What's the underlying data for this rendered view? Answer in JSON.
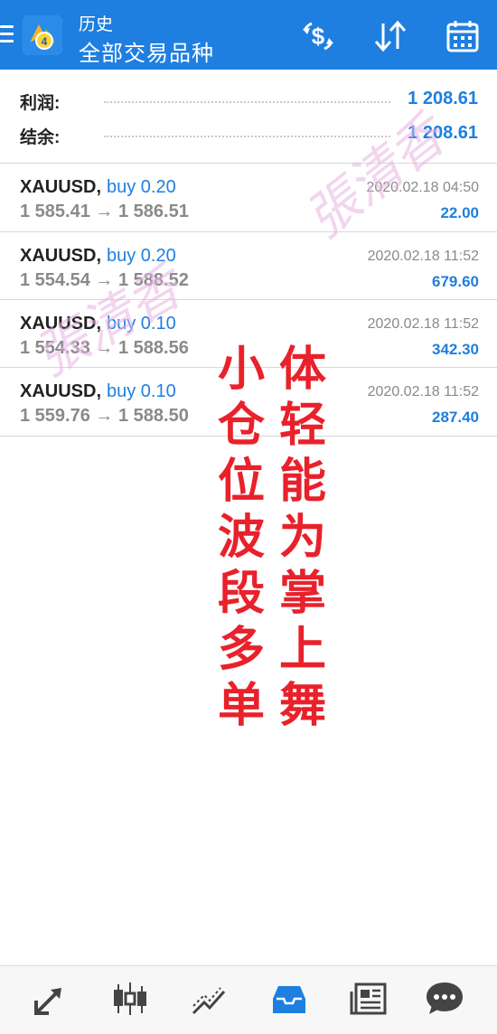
{
  "header": {
    "subtitle": "历史",
    "title": "全部交易品种"
  },
  "summary": {
    "profit_label": "利润:",
    "profit_value": "1 208.61",
    "balance_label": "结余:",
    "balance_value": "1 208.61"
  },
  "trades": [
    {
      "symbol": "XAUUSD,",
      "side": "buy 0.20",
      "prices": "1 585.41 → 1 586.51",
      "time": "2020.02.18 04:50",
      "profit": "22.00"
    },
    {
      "symbol": "XAUUSD,",
      "side": "buy 0.20",
      "prices": "1 554.54 → 1 588.52",
      "time": "2020.02.18 11:52",
      "profit": "679.60"
    },
    {
      "symbol": "XAUUSD,",
      "side": "buy 0.10",
      "prices": "1 554.33 → 1 588.56",
      "time": "2020.02.18 11:52",
      "profit": "342.30"
    },
    {
      "symbol": "XAUUSD,",
      "side": "buy 0.10",
      "prices": "1 559.76 → 1 588.50",
      "time": "2020.02.18 11:52",
      "profit": "287.40"
    }
  ],
  "overlay": {
    "left_column": [
      "小",
      "仓",
      "位",
      "波",
      "段",
      "多",
      "单"
    ],
    "right_column": [
      "体",
      "轻",
      "能",
      "为",
      "掌",
      "上",
      "舞"
    ]
  },
  "watermark": {
    "text": "張清香"
  },
  "icons": {
    "menu": "menu-icon",
    "logo": "metatrader-logo",
    "deposit": "dollar-exchange-icon",
    "sort": "sort-icon",
    "calendar": "calendar-icon",
    "nav": [
      "trade-icon",
      "candlestick-chart-icon",
      "trend-chart-icon",
      "history-inbox-icon",
      "news-icon",
      "chat-icon"
    ]
  },
  "colors": {
    "header": "#1e7fe0",
    "accent": "#1e7fe0",
    "overlay_text": "#e8212b"
  }
}
